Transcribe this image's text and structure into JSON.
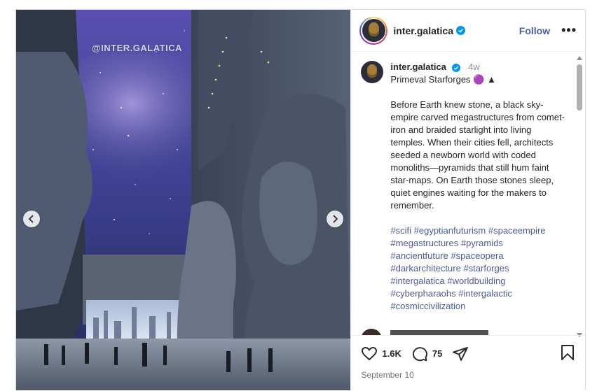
{
  "media": {
    "watermark": "@INTER.GALATICA"
  },
  "header": {
    "username": "inter.galatica",
    "follow_label": "Follow",
    "more_label": "•••"
  },
  "caption": {
    "username": "inter.galatica",
    "time": "4w",
    "title": "Primeval Starforges 🟣 ▲",
    "text": "Before Earth knew stone, a black sky-empire carved megastructures from comet-iron and braided starlight into living temples. When their cities fell, architects seeded a newborn world with coded monoliths—pyramids that still hum faint star-maps. On Earth those stones sleep, quiet engines waiting for the makers to remember.",
    "hashtags": "#scifi #egyptianfuturism #spaceempire\n#megastructures #pyramids\n#ancientfuture #spaceopera\n#darkarchitecture #starforges\n#intergalatica #worldbuilding\n#cyberpharaohs #intergalactic\n#cosmiccivilization"
  },
  "actions": {
    "likes": "1.6K",
    "comments": "75",
    "date": "September 10"
  },
  "colors": {
    "link": "#4a5d9f",
    "verified": "#0095f6"
  }
}
